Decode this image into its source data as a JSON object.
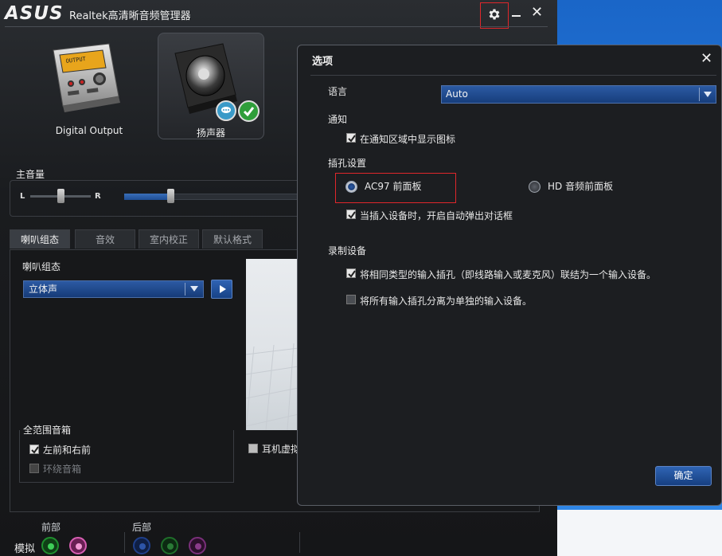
{
  "app": {
    "logo": "ASUS",
    "title": "Realtek高清晰音频管理器"
  },
  "devices": [
    {
      "label": "Digital Output",
      "icon": "digital-output-icon"
    },
    {
      "label": "扬声器",
      "icon": "speaker-icon",
      "selected": true
    }
  ],
  "volume": {
    "label": "主音量",
    "balance_left": "L",
    "balance_right": "R",
    "balance_level": 0.5,
    "master_level": 0.28
  },
  "tabs": [
    {
      "label": "喇叭组态",
      "active": true
    },
    {
      "label": "音效"
    },
    {
      "label": "室内校正"
    },
    {
      "label": "默认格式"
    }
  ],
  "speaker_config": {
    "label": "喇叭组态",
    "selected": "立体声"
  },
  "full_range": {
    "label": "全范围音箱",
    "front_left_right": {
      "label": "左前和右前",
      "checked": true
    },
    "surround": {
      "label": "环绕音箱",
      "checked": false,
      "disabled": true
    }
  },
  "headphone_virtualization_label": "耳机虚拟",
  "jacks": {
    "front_label": "前部",
    "rear_label": "后部",
    "analog_label": "模拟"
  },
  "dialog": {
    "title": "选项",
    "language": {
      "label": "语言",
      "value": "Auto"
    },
    "notify": {
      "label": "通知",
      "show_icon": {
        "label": "在通知区域中显示图标",
        "checked": true
      }
    },
    "jack_settings": {
      "label": "插孔设置",
      "ac97": {
        "label": "AC97 前面板",
        "selected": true
      },
      "hd": {
        "label": "HD 音频前面板",
        "selected": false
      },
      "auto_popup": {
        "label": "当插入设备时，开启自动弹出对话框",
        "checked": true
      }
    },
    "recording": {
      "label": "录制设备",
      "combine": {
        "label": "将相同类型的输入插孔（即线路输入或麦克风）联结为一个输入设备。",
        "checked": true
      },
      "separate": {
        "label": "将所有输入插孔分离为单独的输入设备。",
        "checked": false
      }
    },
    "ok_label": "确定"
  },
  "colors": {
    "accent_blue": "#1e4e95",
    "highlight_red": "#e0272b",
    "jack_green": "#1f8f2e",
    "jack_pink": "#d85fb3",
    "jack_blue": "#1f3f8a",
    "jack_purple": "#7a2f7a"
  }
}
